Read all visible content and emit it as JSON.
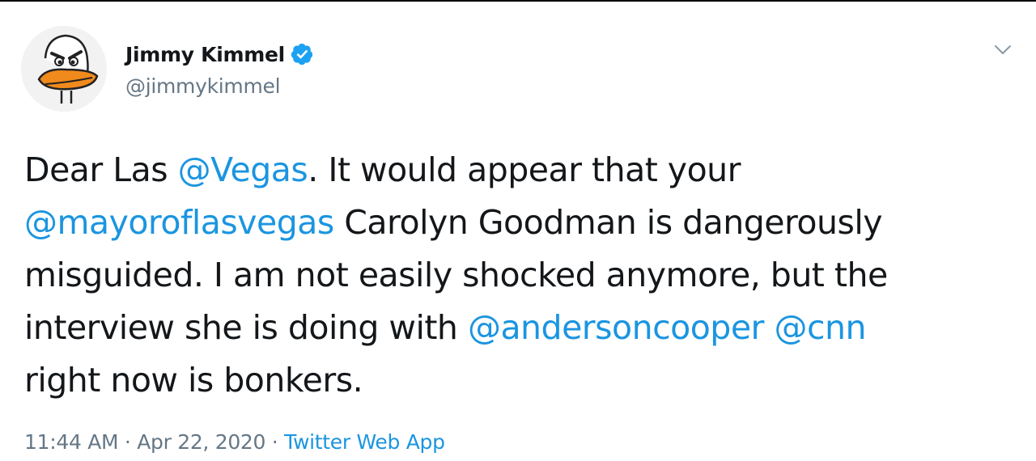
{
  "user": {
    "display_name": "Jimmy Kimmel",
    "handle": "@jimmykimmel",
    "verified_icon": "verified-badge-icon",
    "avatar_icon": "duck-avatar-icon"
  },
  "menu": {
    "caret_icon": "chevron-down-icon"
  },
  "tweet": {
    "line1": {
      "t1": "Dear Las ",
      "m1": "@Vegas",
      "t2": ". It would appear that your"
    },
    "line2": {
      "m1": "@mayoroflasvegas",
      "t1": " Carolyn Goodman is dangerously"
    },
    "line3": {
      "t1": "misguided. I am not easily shocked anymore, but the"
    },
    "line4": {
      "t1": "interview she is doing with ",
      "m1": "@andersoncooper",
      "t2": " ",
      "m2": "@cnn"
    },
    "line5": {
      "t1": "right now is bonkers."
    }
  },
  "meta": {
    "time": "11:44 AM",
    "sep1": " · ",
    "date": "Apr 22, 2020",
    "sep2": " · ",
    "source": "Twitter Web App"
  },
  "colors": {
    "text": "#14171a",
    "secondary": "#657786",
    "link": "#1b95e0",
    "verified": "#1da1f2"
  }
}
